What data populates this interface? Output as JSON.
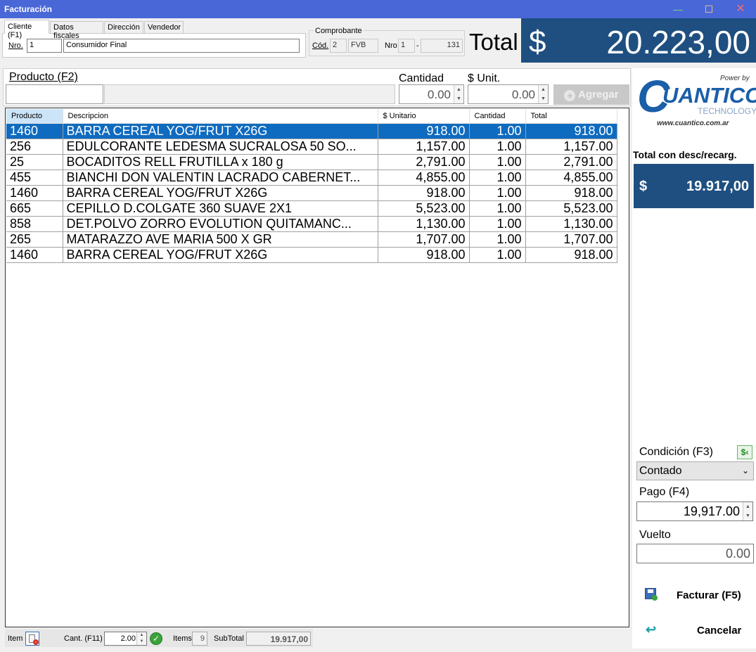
{
  "window": {
    "title": "Facturación",
    "minimize": "—",
    "maximize": "☐",
    "close": "✕"
  },
  "tabs": [
    "Cliente (F1)",
    "Datos fiscales",
    "Dirección",
    "Vendedor"
  ],
  "cliente": {
    "nro_label": "Nro.",
    "nro_value": "1",
    "nombre": "Consumidor Final"
  },
  "comprobante": {
    "group_label": "Comprobante",
    "cod_label": "Cód.",
    "cod_value": "2",
    "tipo": "FVB",
    "nro_label": "Nro",
    "punto_venta": "1",
    "separator": "-",
    "numero": "131"
  },
  "total": {
    "label": "Total",
    "currency": "$",
    "amount": "20.223,00"
  },
  "entry": {
    "producto_label": "Producto (F2)",
    "cantidad_label": "Cantidad",
    "cantidad_value": "0.00",
    "unit_label": "$ Unit.",
    "unit_value": "0.00",
    "agregar_label": "Agregar"
  },
  "grid": {
    "columns": [
      "Producto",
      "Descripcion",
      "$ Unitario",
      "Cantidad",
      "Total"
    ],
    "rows": [
      [
        "1460",
        "BARRA CEREAL YOG/FRUT X26G",
        "918.00",
        "1.00",
        "918.00"
      ],
      [
        "256",
        "EDULCORANTE LEDESMA SUCRALOSA 50 SO...",
        "1,157.00",
        "1.00",
        "1,157.00"
      ],
      [
        "25",
        "BOCADITOS RELL FRUTILLA x 180 g",
        "2,791.00",
        "1.00",
        "2,791.00"
      ],
      [
        "455",
        "BIANCHI DON VALENTIN LACRADO CABERNET...",
        "4,855.00",
        "1.00",
        "4,855.00"
      ],
      [
        "1460",
        "BARRA CEREAL YOG/FRUT X26G",
        "918.00",
        "1.00",
        "918.00"
      ],
      [
        "665",
        "CEPILLO D.COLGATE 360 SUAVE 2X1",
        "5,523.00",
        "1.00",
        "5,523.00"
      ],
      [
        "858",
        "DET.POLVO ZORRO EVOLUTION QUITAMANC...",
        "1,130.00",
        "1.00",
        "1,130.00"
      ],
      [
        "265",
        "MATARAZZO AVE MARIA 500 X GR",
        "1,707.00",
        "1.00",
        "1,707.00"
      ],
      [
        "1460",
        "BARRA CEREAL YOG/FRUT X26G",
        "918.00",
        "1.00",
        "918.00"
      ]
    ],
    "selected_row": 0
  },
  "bottom": {
    "item_label": "Item",
    "cant_label": "Cant. (F11)",
    "cant_value": "2.00",
    "items_label": "Items",
    "items_value": "9",
    "subtotal_label": "SubTotal",
    "subtotal_value": "19.917,00"
  },
  "logo": {
    "power": "Power by",
    "brand": "UANTICO",
    "brand_initial": "C",
    "tech": "TECHNOLOGY",
    "url": "www.cuantico.com.ar"
  },
  "desc": {
    "label": "Total con desc/recarg.",
    "currency": "$",
    "amount": "19.917,00"
  },
  "condicion": {
    "label": "Condición (F3)",
    "value": "Contado"
  },
  "pago": {
    "label": "Pago (F4)",
    "value": "19,917.00"
  },
  "vuelto": {
    "label": "Vuelto",
    "value": "0.00"
  },
  "actions": {
    "facturar": "Facturar (F5)",
    "cancelar": "Cancelar"
  },
  "colors": {
    "accent": "#1e4f80",
    "selection": "#0f6bbf",
    "titlebar": "#4a67d8"
  }
}
